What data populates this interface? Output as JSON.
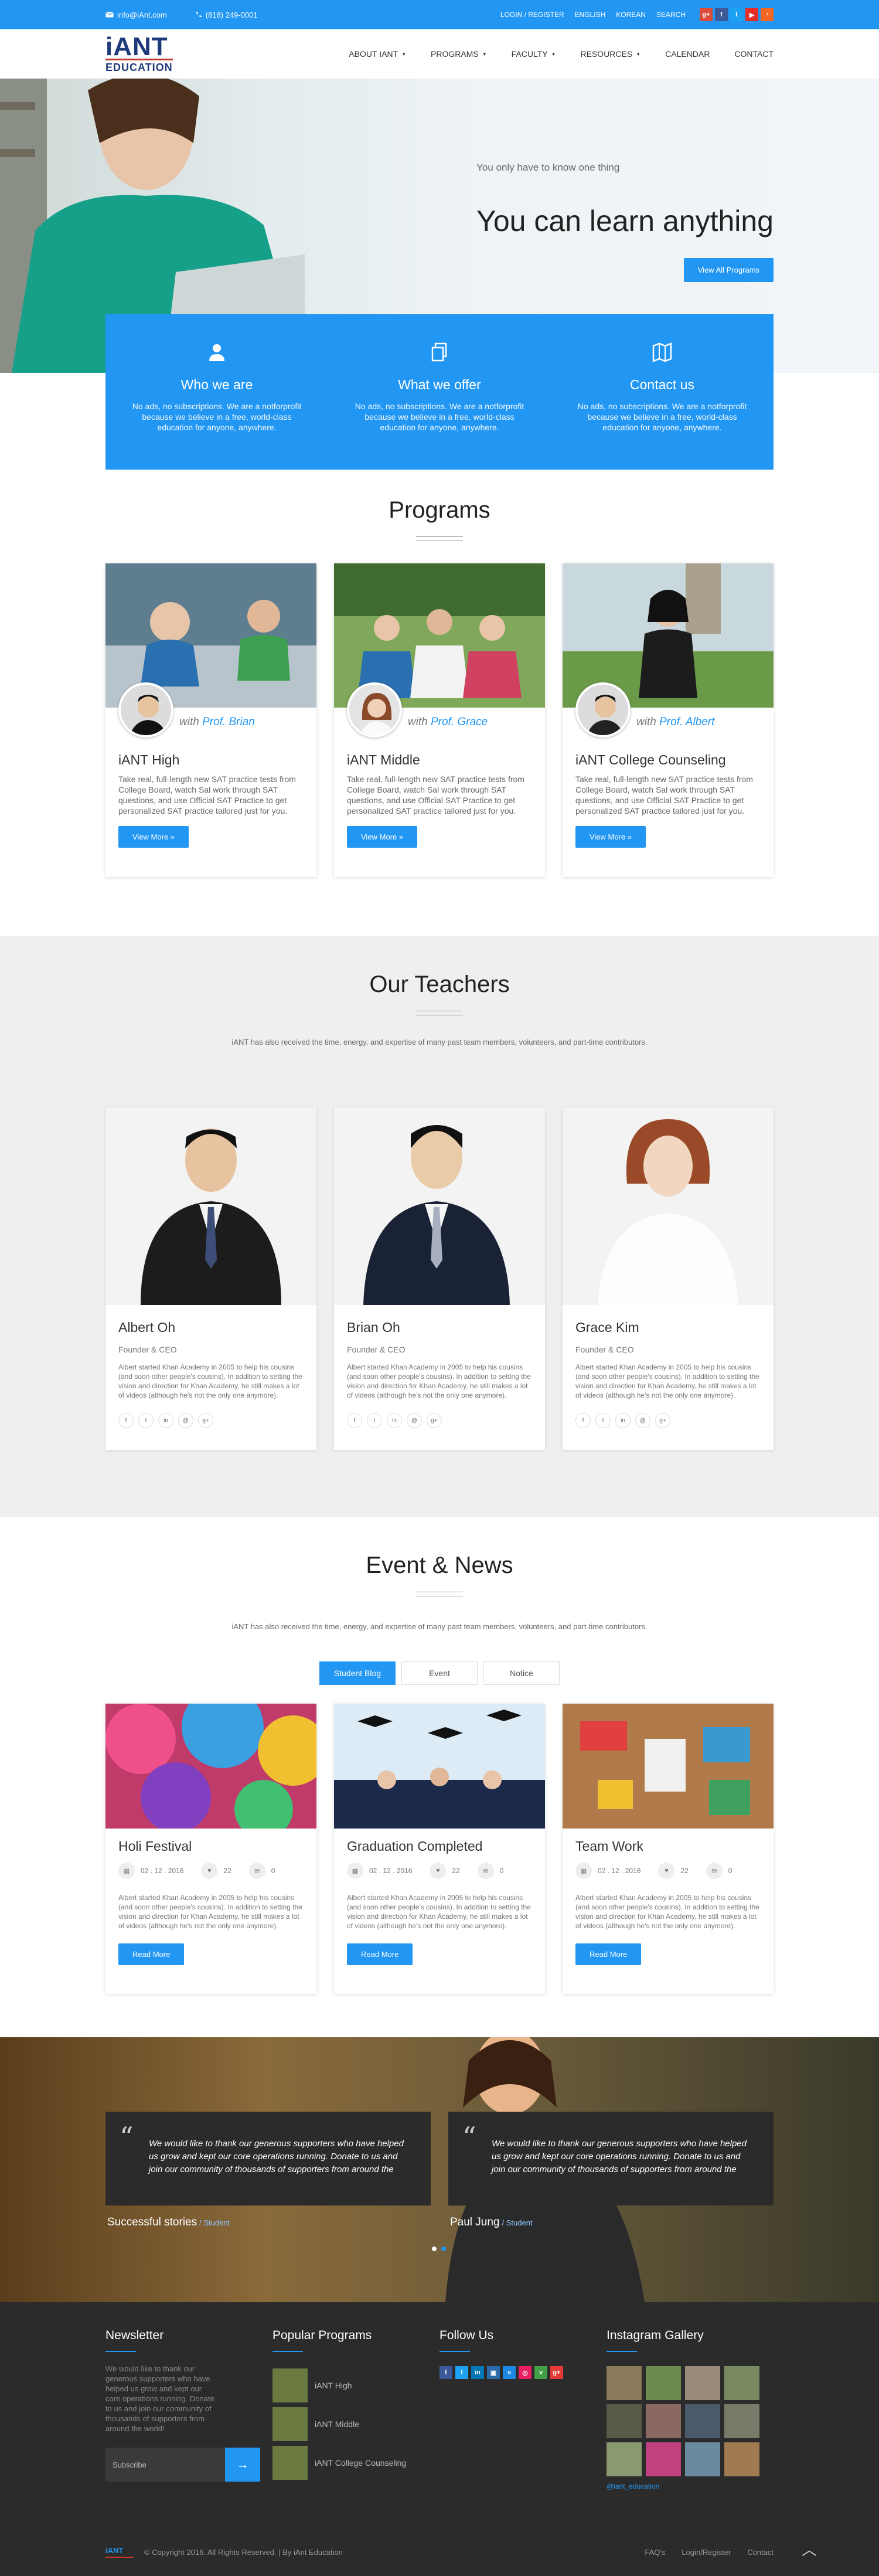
{
  "topbar": {
    "email": "info@iAnt.com",
    "phone": "(818) 249-0001",
    "links": [
      "LOGIN / REGISTER",
      "ENGLISH",
      "KOREAN",
      "SEARCH"
    ],
    "social_colors": {
      "google": "#dd4b39",
      "facebook": "#3b5998",
      "twitter": "#1da1f2",
      "youtube": "#e52d27",
      "rss": "#f26522"
    }
  },
  "logo": {
    "line1": "iANT",
    "line2": "EDUCATION"
  },
  "nav": [
    "ABOUT IANT",
    "PROGRAMS",
    "FACULTY",
    "RESOURCES",
    "CALENDAR",
    "CONTACT"
  ],
  "hero": {
    "subtitle": "You only have to know one thing",
    "title": "You can learn anything",
    "button": "View All Programs"
  },
  "features": [
    {
      "icon": "user-icon",
      "title": "Who we are",
      "text": "No ads, no subscriptions. We are a notforprofit because we believe in a free, world-class education for anyone, anywhere."
    },
    {
      "icon": "copy-icon",
      "title": "What we offer",
      "text": "No ads, no subscriptions. We are a notforprofit because we believe in a free, world-class education for anyone, anywhere."
    },
    {
      "icon": "map-icon",
      "title": "Contact us",
      "text": "No ads, no subscriptions. We are a notforprofit because we believe in a free, world-class education for anyone, anywhere."
    }
  ],
  "programs": {
    "title": "Programs",
    "with_label": "with",
    "button": "View More »",
    "items": [
      {
        "prof": "Prof. Brian",
        "title": "iANT High",
        "text": "Take real, full-length new SAT practice tests from College Board, watch Sal work through SAT questions, and use Official SAT Practice to get personalized SAT practice tailored just for you."
      },
      {
        "prof": "Prof. Grace",
        "title": "iANT Middle",
        "text": "Take real, full-length new SAT practice tests from College Board, watch Sal work through SAT questions, and use Official SAT Practice to get personalized SAT practice tailored just for you."
      },
      {
        "prof": "Prof. Albert",
        "title": "iANT College Counseling",
        "text": "Take real, full-length new SAT practice tests from College Board, watch Sal work through SAT questions, and use Official SAT Practice to get personalized SAT practice tailored just for you."
      }
    ]
  },
  "teachers": {
    "title": "Our Teachers",
    "desc": "iANT has also received the time, energy, and expertise of many past team members, volunteers, and part-time contributors.",
    "items": [
      {
        "name": "Albert Oh",
        "role": "Founder & CEO",
        "bio": "Albert started Khan Academy in 2005 to help his cousins (and soon other people's cousins). In addition to setting the vision and direction for Khan Academy, he still makes a lot of videos (although he's not the only one anymore)."
      },
      {
        "name": "Brian Oh",
        "role": "Founder & CEO",
        "bio": "Albert started Khan Academy in 2005 to help his cousins (and soon other people's cousins). In addition to setting the vision and direction for Khan Academy, he still makes a lot of videos (although he's not the only one anymore)."
      },
      {
        "name": "Grace Kim",
        "role": "Founder & CEO",
        "bio": "Albert started Khan Academy in 2005 to help his cousins (and soon other people's cousins). In addition to setting the vision and direction for Khan Academy, he still makes a lot of videos (although he's not the only one anymore)."
      }
    ],
    "social": [
      "f",
      "t",
      "in",
      "@",
      "g+"
    ]
  },
  "events": {
    "title": "Event & News",
    "desc": "iANT has also received the time, energy, and expertise of many past team members, volunteers, and part-time contributors.",
    "tabs": [
      "Student Blog",
      "Event",
      "Notice"
    ],
    "button": "Read More",
    "items": [
      {
        "title": "Holi Festival",
        "date": "02 . 12 . 2016",
        "likes": "22",
        "comments": "0",
        "text": "Albert started Khan Academy in 2005 to help his cousins (and soon other people's cousins). In addition to setting the vision and direction for Khan Academy, he still makes a lot of videos (although he's not the only one anymore)."
      },
      {
        "title": "Graduation Completed",
        "date": "02 . 12 . 2016",
        "likes": "22",
        "comments": "0",
        "text": "Albert started Khan Academy in 2005 to help his cousins (and soon other people's cousins). In addition to setting the vision and direction for Khan Academy, he still makes a lot of videos (although he's not the only one anymore)."
      },
      {
        "title": "Team Work",
        "date": "02 . 12 . 2016",
        "likes": "22",
        "comments": "0",
        "text": "Albert started Khan Academy in 2005 to help his cousins (and soon other people's cousins). In addition to setting the vision and direction for Khan Academy, he still makes a lot of videos (although he's not the only one anymore)."
      }
    ]
  },
  "testimonials": {
    "quote": "We would like to thank our generous supporters who have helped us grow and kept our core operations running. Donate to us and join our community of thousands of supporters from around the",
    "items": [
      {
        "name": "Successful stories",
        "tag": "/ Student"
      },
      {
        "name": "Paul Jung",
        "tag": "/ Student"
      }
    ]
  },
  "footer": {
    "newsletter": {
      "title": "Newsletter",
      "text": "We would like to thank our generous supporters who have helped us grow and kept our core operations running. Donate to us and join our community of thousands of supporters from around the world!",
      "placeholder": "Subscribe"
    },
    "popular": {
      "title": "Popular Programs",
      "items": [
        "iANT High",
        "iANT Middle",
        "iANT College Counseling"
      ]
    },
    "follow": {
      "title": "Follow Us"
    },
    "instagram": {
      "title": "Instagram Gallery",
      "handle": "@iant_education"
    },
    "copyright": "© Copyright 2016. All Rights Reserved. | By iAnt Education",
    "links": [
      "FAQ's",
      "Login/Register",
      "Contact"
    ]
  }
}
